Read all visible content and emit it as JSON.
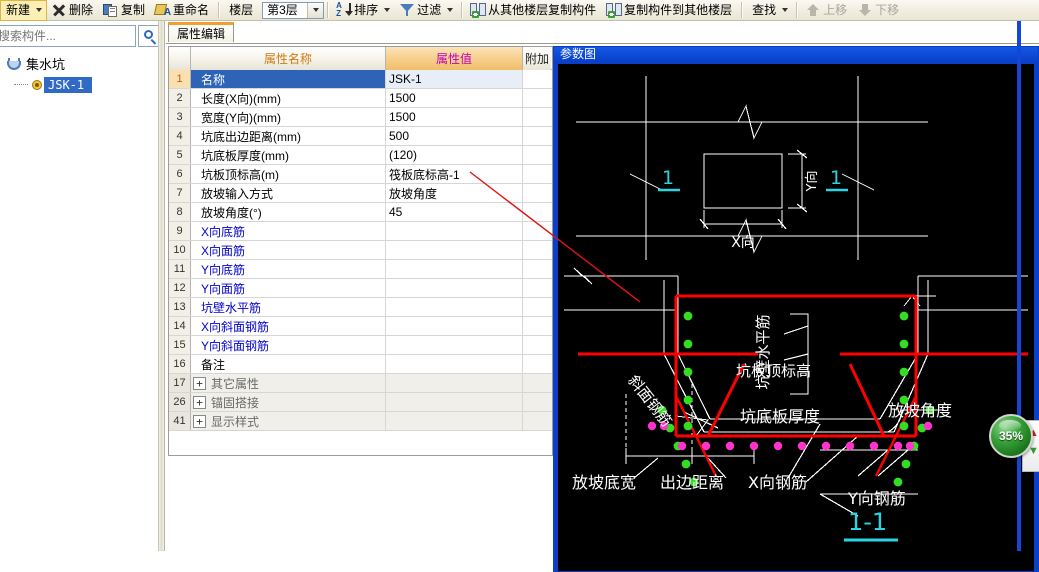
{
  "toolbar": {
    "new_label": "新建",
    "delete_label": "删除",
    "copy_label": "复制",
    "rename_label": "重命名",
    "floor_label": "楼层",
    "floor_value": "第3层",
    "sort_label": "排序",
    "filter_label": "过滤",
    "copy_from_other_floor_label": "从其他楼层复制构件",
    "copy_to_other_floor_label": "复制构件到其他楼层",
    "find_label": "查找",
    "move_up_label": "上移",
    "move_down_label": "下移"
  },
  "sidebar": {
    "search_placeholder": "搜索构件...",
    "search_value": "",
    "tree": {
      "root_label": "集水坑",
      "child_label": "JSK-1"
    }
  },
  "tabs": [
    {
      "label": "属性编辑",
      "active": true
    }
  ],
  "grid": {
    "columns": {
      "rownum": "",
      "name": "属性名称",
      "value": "属性值",
      "extra": "附加"
    },
    "rows": [
      {
        "num": "1",
        "name": "名称",
        "value": "JSK-1",
        "style": "selected"
      },
      {
        "num": "2",
        "name": "长度(X向)(mm)",
        "value": "1500",
        "style": "normal"
      },
      {
        "num": "3",
        "name": "宽度(Y向)(mm)",
        "value": "1500",
        "style": "normal"
      },
      {
        "num": "4",
        "name": "坑底出边距离(mm)",
        "value": "500",
        "style": "normal"
      },
      {
        "num": "5",
        "name": "坑底板厚度(mm)",
        "value": "(120)",
        "style": "normal"
      },
      {
        "num": "6",
        "name": "坑板顶标高(m)",
        "value": "筏板底标高-1",
        "style": "normal"
      },
      {
        "num": "7",
        "name": "放坡输入方式",
        "value": "放坡角度",
        "style": "normal"
      },
      {
        "num": "8",
        "name": "放坡角度(°)",
        "value": "45",
        "style": "normal"
      },
      {
        "num": "9",
        "name": "X向底筋",
        "value": "",
        "style": "link"
      },
      {
        "num": "10",
        "name": "X向面筋",
        "value": "",
        "style": "link"
      },
      {
        "num": "11",
        "name": "Y向底筋",
        "value": "",
        "style": "link"
      },
      {
        "num": "12",
        "name": "Y向面筋",
        "value": "",
        "style": "link"
      },
      {
        "num": "13",
        "name": "坑壁水平筋",
        "value": "",
        "style": "link"
      },
      {
        "num": "14",
        "name": "X向斜面钢筋",
        "value": "",
        "style": "link"
      },
      {
        "num": "15",
        "name": "Y向斜面钢筋",
        "value": "",
        "style": "link"
      },
      {
        "num": "16",
        "name": "备注",
        "value": "",
        "style": "normal"
      },
      {
        "num": "17",
        "name": "其它属性",
        "value": "",
        "style": "group",
        "expander": "+"
      },
      {
        "num": "26",
        "name": "锚固搭接",
        "value": "",
        "style": "group",
        "expander": "+"
      },
      {
        "num": "41",
        "name": "显示样式",
        "value": "",
        "style": "group",
        "expander": "+"
      }
    ]
  },
  "diagram": {
    "title": "参数图",
    "section_marks": {
      "left": "1",
      "right": "1",
      "bottom": "1-1"
    },
    "labels": {
      "x_dir": "X向",
      "y_dir": "Y向",
      "pit_wall_horizontal_rebar": "坑壁水平筋",
      "pit_slab_top_elevation": "坑板顶标高",
      "pit_bottom_slab_thickness": "坑底板厚度",
      "slope_face_rebar": "斜面钢筋",
      "slope_bottom_width": "放坡底宽",
      "edge_distance": "出边距离",
      "x_dir_rebar": "X向钢筋",
      "y_dir_rebar": "Y向钢筋",
      "slope_angle": "放坡角度"
    },
    "colors": {
      "background": "#000000",
      "outline": "#ffffff",
      "rebar_main": "#ff0000",
      "rebar_dot_green": "#33dd22",
      "rebar_dot_magenta": "#ff33cc",
      "section_mark": "#2ad4e0"
    }
  },
  "overlay": {
    "progress_badge": "35%"
  }
}
